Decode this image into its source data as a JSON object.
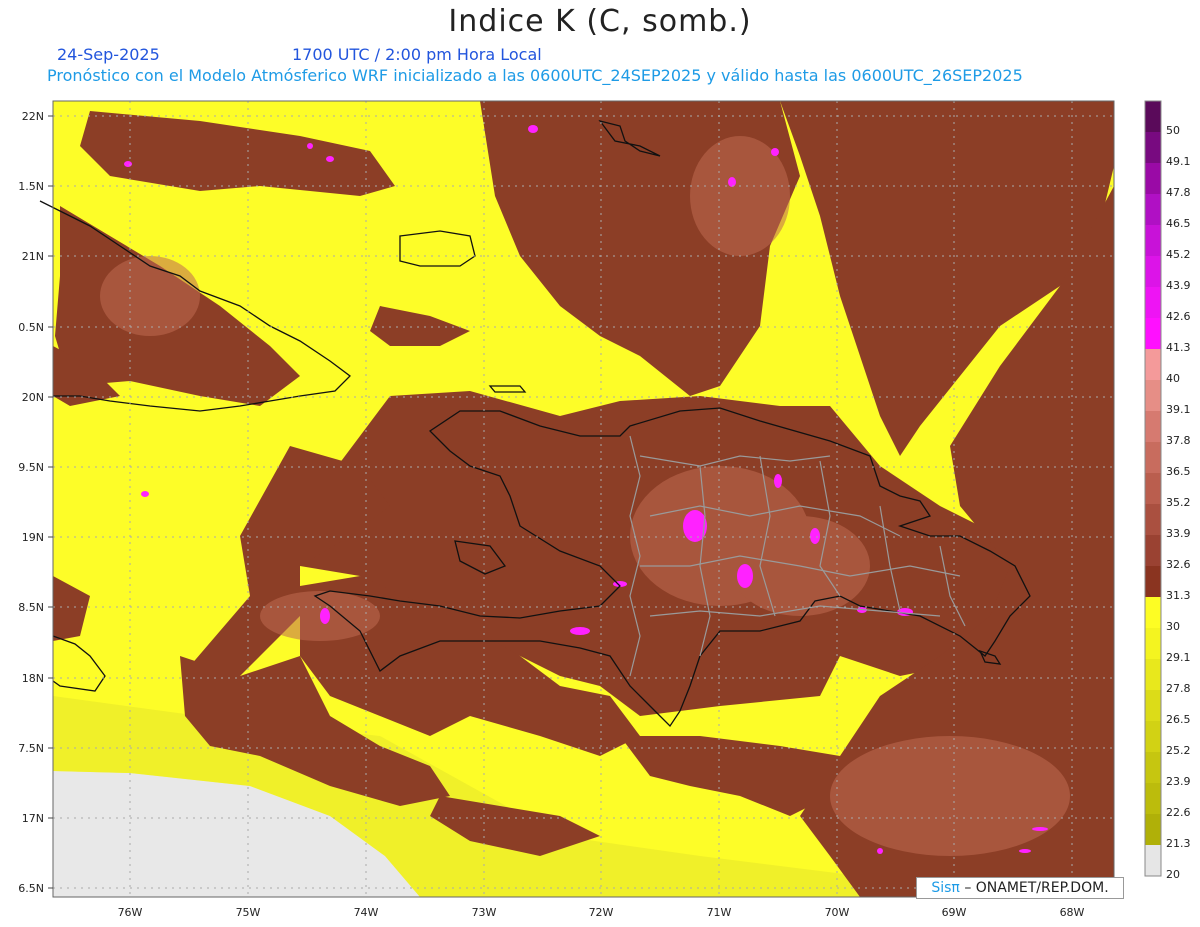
{
  "header": {
    "title": "Indice K (C, somb.)",
    "date": "24-Sep-2025",
    "time": "1700 UTC / 2:00 pm Hora Local",
    "forecast": "Pronóstico con el Modelo Atmósferico WRF inicializado a las 0600UTC_24SEP2025 y válido hasta las  0600UTC_26SEP2025"
  },
  "credit": {
    "logo": "SisPI",
    "logo_glyph": "Sisπ",
    "text": "– ONAMET/REP.DOM."
  },
  "axes": {
    "lon_labels": [
      "76W",
      "75W",
      "74W",
      "73W",
      "72W",
      "71W",
      "70W",
      "69W",
      "68W"
    ],
    "lat_labels": [
      "22N",
      "1.5N",
      "21N",
      "0.5N",
      "20N",
      "9.5N",
      "19N",
      "8.5N",
      "18N",
      "7.5N",
      "17N",
      "6.5N"
    ]
  },
  "colorbar": {
    "labels": [
      "50",
      "49.1",
      "47.8",
      "46.5",
      "45.2",
      "43.9",
      "42.6",
      "41.3",
      "40",
      "39.1",
      "37.8",
      "36.5",
      "35.2",
      "33.9",
      "32.6",
      "31.3",
      "30",
      "29.1",
      "27.8",
      "26.5",
      "25.2",
      "23.9",
      "22.6",
      "21.3",
      "20"
    ],
    "colors": [
      "#5a0a5a",
      "#780a80",
      "#9a0aa6",
      "#b010c4",
      "#c812d8",
      "#dc14e8",
      "#ee14f4",
      "#ff10ff",
      "#f49a9a",
      "#e68e86",
      "#d67a70",
      "#c86c5e",
      "#ba5e4e",
      "#aa5040",
      "#9a4232",
      "#8a3420",
      "#fdfd24",
      "#f4f420",
      "#e8e81c",
      "#dcdc18",
      "#d2d214",
      "#c6c610",
      "#bcbc0c",
      "#b0b008",
      "#e6e6e6"
    ]
  },
  "map": {
    "lon_range": [
      -76.65,
      -67.6
    ],
    "lat_range": [
      16.42,
      22.1
    ],
    "ocean_color": "#fdfd28",
    "k_color": "#8c3e26",
    "gridline_color": "#aaaaaa"
  }
}
